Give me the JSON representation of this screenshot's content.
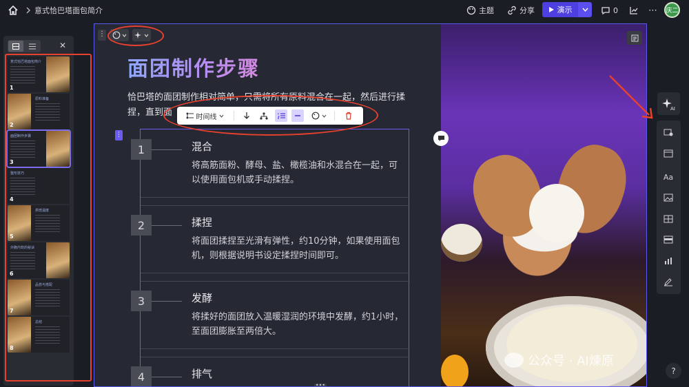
{
  "topbar": {
    "doc_title": "意式恰巴塔面包简介",
    "theme_label": "主题",
    "share_label": "分享",
    "present_label": "演示",
    "comment_count": "0",
    "avatar_text": "庆二"
  },
  "thumbnails": [
    {
      "num": "1",
      "title": "意式恰巴塔面包简介",
      "image_side": "right"
    },
    {
      "num": "2",
      "title": "原料准备",
      "image_side": "left"
    },
    {
      "num": "3",
      "title": "面团制作步骤",
      "image_side": "right",
      "selected": true
    },
    {
      "num": "4",
      "title": "整形技巧",
      "image_side": "none"
    },
    {
      "num": "5",
      "title": "烘焙温度",
      "image_side": "left"
    },
    {
      "num": "6",
      "title": "外脆内软的秘诀",
      "image_side": "right"
    },
    {
      "num": "7",
      "title": "品尝与搭配",
      "image_side": "left"
    },
    {
      "num": "8",
      "title": "总结",
      "image_side": "left"
    }
  ],
  "slide": {
    "heading": "面团制作步骤",
    "intro": "恰巴塔的面团制作相对简单，只需将所有原料混合在一起，然后进行揉捏，直到面",
    "floating_toolbar": {
      "layout_label": "时间线"
    },
    "steps": [
      {
        "num": "1",
        "title": "混合",
        "desc": "将高筋面粉、酵母、盐、橄榄油和水混合在一起，可以使用面包机或手动揉捏。"
      },
      {
        "num": "2",
        "title": "揉捏",
        "desc": "将面团揉捏至光滑有弹性，约10分钟，如果使用面包机，则根据说明书设定揉捏时间即可。"
      },
      {
        "num": "3",
        "title": "发酵",
        "desc": "将揉好的面团放入温暖湿润的环境中发酵，约1小时，至面团膨胀至两倍大。"
      },
      {
        "num": "4",
        "title": "排气",
        "desc": ""
      }
    ]
  },
  "watermark": "公众号 · AI煉原",
  "help_label": "?",
  "colors": {
    "accent": "#4d3fe0",
    "annotation_red": "#e8412e",
    "selection": "#6a5cf0"
  }
}
